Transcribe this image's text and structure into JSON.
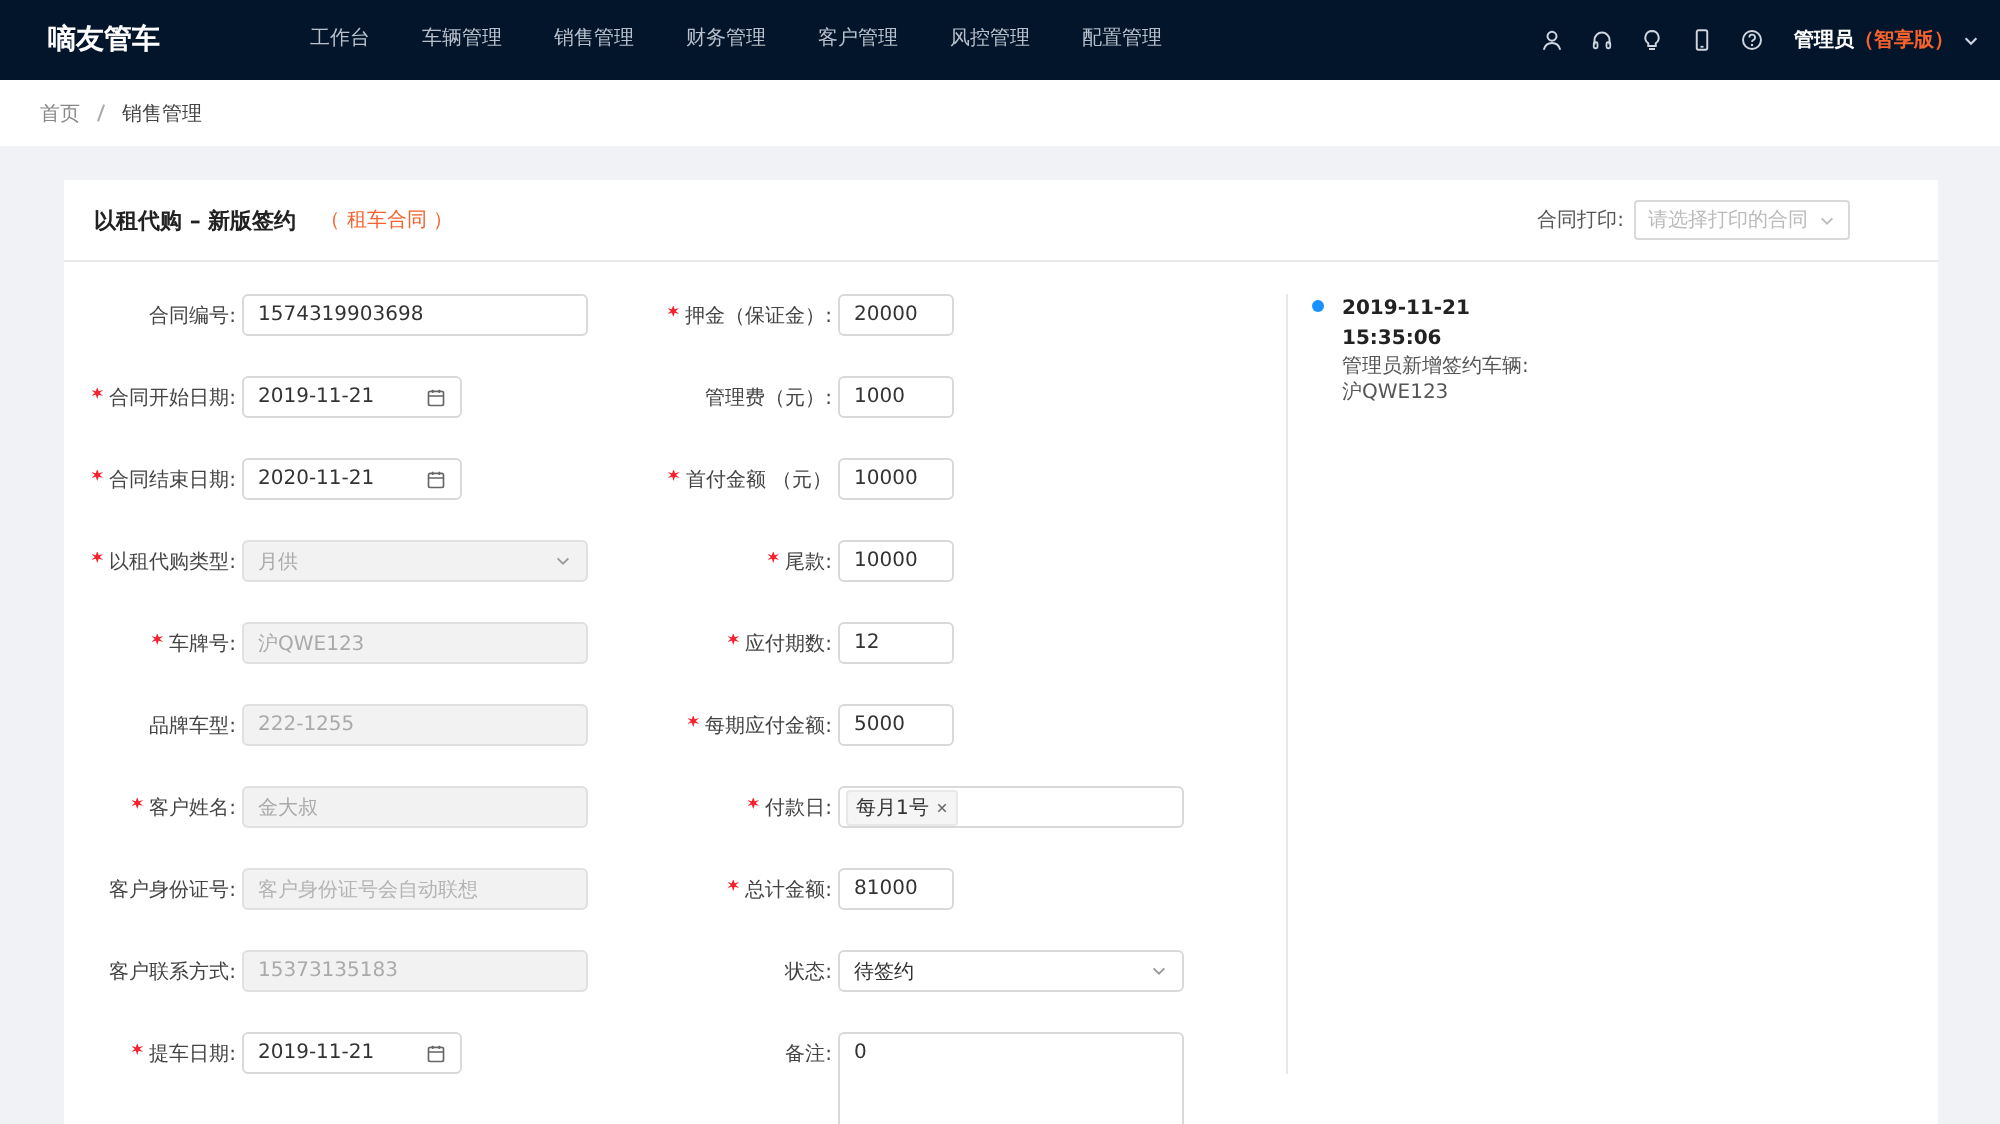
{
  "header": {
    "logo": "嘀友管车",
    "nav": [
      {
        "label": "工作台",
        "selected": false
      },
      {
        "label": "车辆管理",
        "selected": false
      },
      {
        "label": "销售管理",
        "selected": false
      },
      {
        "label": "财务管理",
        "selected": false
      },
      {
        "label": "客户管理",
        "selected": false
      },
      {
        "label": "风控管理",
        "selected": false
      },
      {
        "label": "配置管理",
        "selected": false
      }
    ],
    "user": "管理员",
    "edition": "（智享版）"
  },
  "breadcrumb": [
    "首页",
    "销售管理"
  ],
  "card": {
    "title": "以租代购 – 新版签约",
    "tag": "（ 租车合同 ）",
    "print_label": "合同打印:",
    "print_placeholder": "请选择打印的合同"
  },
  "form_left": [
    {
      "label": "合同编号:",
      "required": false,
      "kind": "text",
      "value": "1574319903698",
      "disabled": false
    },
    {
      "label": "合同开始日期:",
      "required": true,
      "kind": "date",
      "value": "2019-11-21",
      "disabled": false
    },
    {
      "label": "合同结束日期:",
      "required": true,
      "kind": "date",
      "value": "2020-11-21",
      "disabled": false
    },
    {
      "label": "以租代购类型:",
      "required": true,
      "kind": "select",
      "value": "月供",
      "disabled": true
    },
    {
      "label": "车牌号:",
      "required": true,
      "kind": "text",
      "value": "沪QWE123",
      "disabled": true
    },
    {
      "label": "品牌车型:",
      "required": false,
      "kind": "text",
      "value": "222-1255",
      "disabled": true
    },
    {
      "label": "客户姓名:",
      "required": true,
      "kind": "text",
      "value": "金大叔",
      "disabled": true
    },
    {
      "label": "客户身份证号:",
      "required": false,
      "kind": "text",
      "placeholder": "客户身份证号会自动联想",
      "disabled": true
    },
    {
      "label": "客户联系方式:",
      "required": false,
      "kind": "text",
      "value": "15373135183",
      "disabled": true
    },
    {
      "label": "提车日期:",
      "required": true,
      "kind": "date",
      "value": "2019-11-21",
      "disabled": false
    }
  ],
  "form_right": [
    {
      "label": "押金（保证金）:",
      "required": true,
      "kind": "text",
      "value": "20000",
      "disabled": false
    },
    {
      "label": "管理费（元）:",
      "required": false,
      "kind": "text",
      "value": "1000",
      "disabled": false
    },
    {
      "label": "首付金额 （元）",
      "required": true,
      "kind": "text",
      "value": "10000",
      "disabled": false
    },
    {
      "label": "尾款:",
      "required": true,
      "kind": "text",
      "value": "10000",
      "disabled": false
    },
    {
      "label": "应付期数:",
      "required": true,
      "kind": "text",
      "value": "12",
      "disabled": false
    },
    {
      "label": "每期应付金额:",
      "required": true,
      "kind": "text",
      "value": "5000",
      "disabled": false
    },
    {
      "label": "付款日:",
      "required": true,
      "kind": "tags",
      "tags": [
        "每月1号"
      ],
      "disabled": false
    },
    {
      "label": "总计金额:",
      "required": true,
      "kind": "text",
      "value": "81000",
      "disabled": false
    },
    {
      "label": "状态:",
      "required": false,
      "kind": "select",
      "value": "待签约",
      "disabled": false
    },
    {
      "label": "备注:",
      "required": false,
      "kind": "textarea",
      "value": "0",
      "disabled": false
    }
  ],
  "timeline": [
    {
      "date": "2019-11-21",
      "time": "15:35:06",
      "text": "管理员新增签约车辆:",
      "plate": "沪QWE123",
      "color": "#1890ff"
    }
  ]
}
